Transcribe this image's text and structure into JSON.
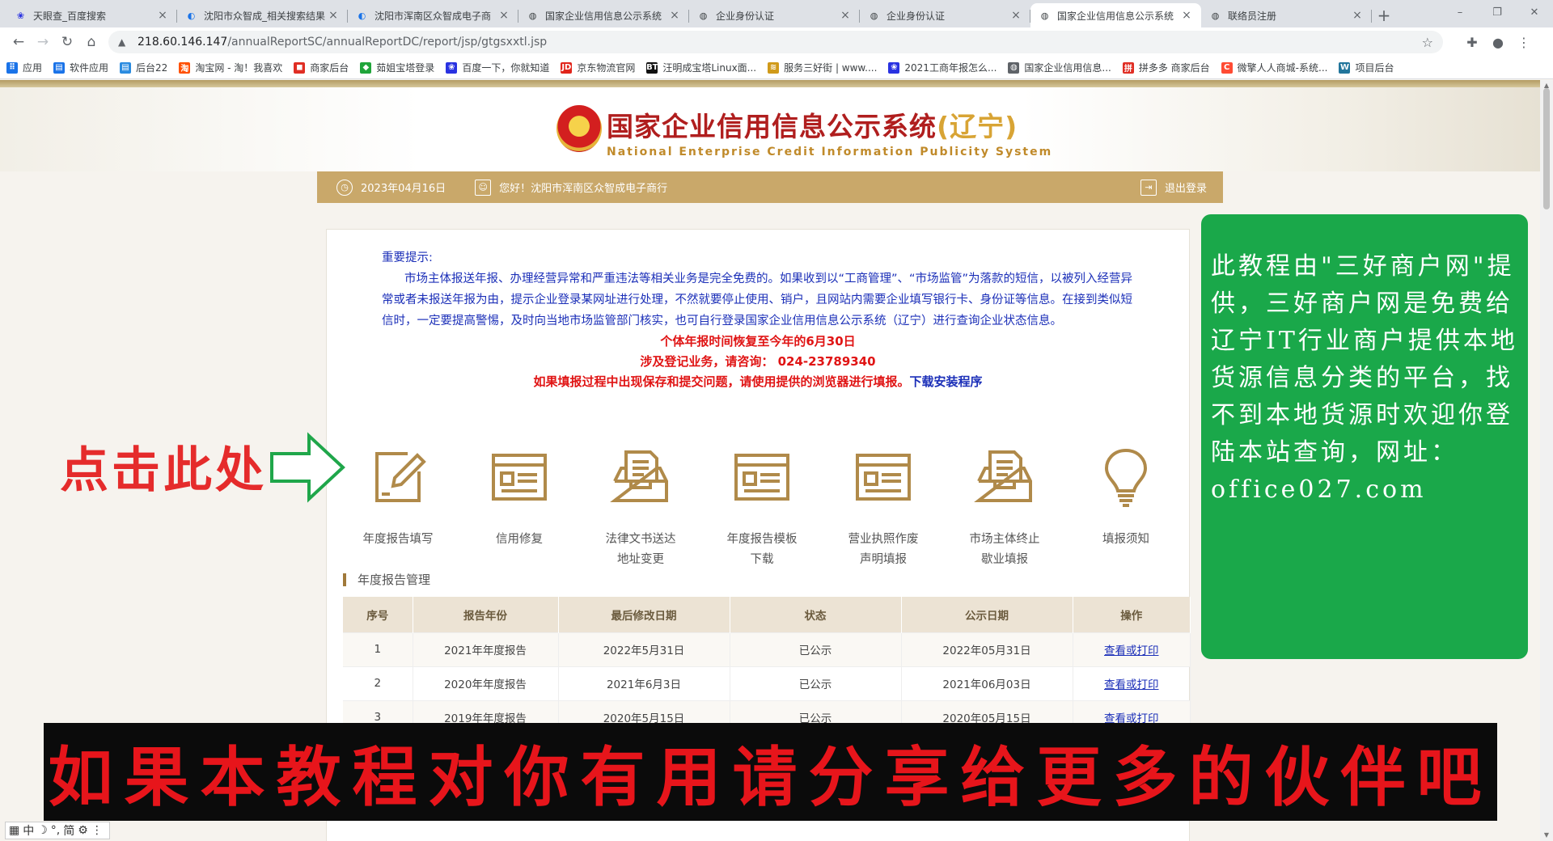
{
  "tabs": [
    {
      "title": "天眼查_百度搜索",
      "icon": "baidu-icon",
      "active": false
    },
    {
      "title": "沈阳市众智成_相关搜索结果",
      "icon": "c-logo-icon",
      "active": false
    },
    {
      "title": "沈阳市浑南区众智成电子商",
      "icon": "c-logo-icon",
      "active": false
    },
    {
      "title": "国家企业信用信息公示系统",
      "icon": "globe-icon",
      "active": false
    },
    {
      "title": "企业身份认证",
      "icon": "globe-icon",
      "active": false
    },
    {
      "title": "企业身份认证",
      "icon": "globe-icon",
      "active": false
    },
    {
      "title": "国家企业信用信息公示系统",
      "icon": "globe-icon",
      "active": true
    },
    {
      "title": "联络员注册",
      "icon": "globe-icon",
      "active": false
    }
  ],
  "address": {
    "host": "218.60.146.147",
    "path": "/annualReportSC/annualReportDC/report/jsp/gtgsxxtl.jsp"
  },
  "bookmarks": [
    {
      "label": "应用",
      "icon": "apps-grid-icon",
      "color": "#1a73e8"
    },
    {
      "label": "软件应用",
      "icon": "folder-icon",
      "color": "#1a73e8"
    },
    {
      "label": "后台22",
      "icon": "folder-icon",
      "color": "#2a8be0"
    },
    {
      "label": "淘宝网 - 淘！我喜欢",
      "icon": "taobao-icon",
      "color": "#ff5000"
    },
    {
      "label": "商家后台",
      "icon": "store-icon",
      "color": "#e02e24"
    },
    {
      "label": "茹姐宝塔登录",
      "icon": "shield-icon",
      "color": "#20a53a"
    },
    {
      "label": "百度一下，你就知道",
      "icon": "baidu-icon",
      "color": "#2932e1"
    },
    {
      "label": "京东物流官网",
      "icon": "jd-icon",
      "color": "#e1251b"
    },
    {
      "label": "汪明成宝塔Linux面...",
      "icon": "bt-icon",
      "color": "#111111"
    },
    {
      "label": "服务三好街 | www....",
      "icon": "stack-icon",
      "color": "#d09a1a"
    },
    {
      "label": "2021工商年报怎么...",
      "icon": "baidu-icon",
      "color": "#2932e1"
    },
    {
      "label": "国家企业信用信息...",
      "icon": "globe-icon",
      "color": "#5f6368"
    },
    {
      "label": "拼多多 商家后台",
      "icon": "pdd-icon",
      "color": "#e02e24"
    },
    {
      "label": "微擎人人商城-系统...",
      "icon": "c-logo-icon",
      "color": "#ff4b33"
    },
    {
      "label": "项目后台",
      "icon": "wordpress-icon",
      "color": "#21759b"
    }
  ],
  "header": {
    "title_main": "国家企业信用信息公示系统",
    "title_province": "(辽宁)",
    "subtitle": "National  Enterprise  Credit  Information  Publicity  System"
  },
  "userbar": {
    "date": "2023年04月16日",
    "greeting": "您好！沈阳市浑南区众智成电子商行",
    "logout": "退出登录"
  },
  "notice": {
    "heading": "重要提示:",
    "body": "市场主体报送年报、办理经营异常和严重违法等相关业务是完全免费的。如果收到以“工商管理”、“市场监管”为落款的短信，以被列入经营异常或者未报送年报为由，提示企业登录某网址进行处理，不然就要停止使用、销户，且网站内需要企业填写银行卡、身份证等信息。在接到类似短信时，一定要提高警惕，及时向当地市场监管部门核实，也可自行登录国家企业信用信息公示系统（辽宁）进行查询企业状态信息。",
    "red1": "个体年报时间恢复至今年的6月30日",
    "red2": "涉及登记业务，请咨询：  024-23789340",
    "red3": "如果填报过程中出现保存和提交问题，请使用提供的浏览器进行填报。",
    "download_link": "下载安装程序"
  },
  "functions": [
    {
      "label1": "年度报告填写",
      "label2": "",
      "icon": "edit-form-icon"
    },
    {
      "label1": "信用修复",
      "label2": "",
      "icon": "document-window-icon"
    },
    {
      "label1": "法律文书送达",
      "label2": "地址变更",
      "icon": "inbox-tray-icon"
    },
    {
      "label1": "年度报告模板",
      "label2": "下载",
      "icon": "document-window-icon"
    },
    {
      "label1": "营业执照作废",
      "label2": "声明填报",
      "icon": "document-window-icon"
    },
    {
      "label1": "市场主体终止",
      "label2": "歇业填报",
      "icon": "inbox-tray-icon"
    },
    {
      "label1": "填报须知",
      "label2": "",
      "icon": "lightbulb-icon"
    }
  ],
  "section_title": "年度报告管理",
  "table": {
    "headers": [
      "序号",
      "报告年份",
      "最后修改日期",
      "状态",
      "公示日期",
      "操作"
    ],
    "rows": [
      [
        "1",
        "2021年年度报告",
        "2022年5月31日",
        "已公示",
        "2022年05月31日",
        "查看或打印"
      ],
      [
        "2",
        "2020年年度报告",
        "2021年6月3日",
        "已公示",
        "2021年06月03日",
        "查看或打印"
      ],
      [
        "3",
        "2019年年度报告",
        "2020年5月15日",
        "已公示",
        "2020年05月15日",
        "查看或打印"
      ]
    ]
  },
  "overlay": {
    "click_here": "点击此处",
    "promo": "此教程由\"三好商户网\"提供，三好商户网是免费给辽宁IT行业商户提供本地货源信息分类的平台，找不到本地货源时欢迎你登陆本站查询，网址：office027.com",
    "share": "如果本教程对你有用请分享给更多的伙伴吧"
  },
  "ime": {
    "mode": "中",
    "punct": "简"
  },
  "colors": {
    "accent_gold": "#c9a86a",
    "promo_green": "#1aa84a",
    "overlay_red": "#e7151b",
    "notice_blue": "#1b2fb8"
  }
}
